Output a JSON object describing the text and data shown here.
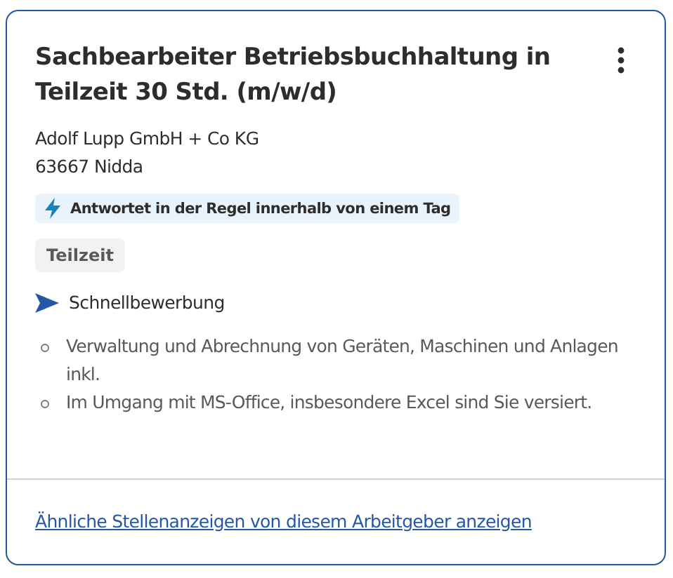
{
  "job": {
    "title": "Sachbearbeiter Betriebsbuchhaltung in Teilzeit 30 Std. (m/w/d)",
    "company": "Adolf Lupp GmbH + Co KG",
    "location": "63667 Nidda",
    "response_badge": "Antwortet in der Regel innerhalb von einem Tag",
    "tags": [
      "Teilzeit"
    ],
    "quick_apply": "Schnellbewerbung",
    "snippets": [
      "Verwaltung und Abrechnung von Geräten, Maschinen und Anlagen inkl.",
      "Im Umgang mit MS-Office, insbesondere Excel sind Sie versiert."
    ]
  },
  "footer_link": "Ähnliche Stellenanzeigen von diesem Arbeitgeber anzeigen"
}
